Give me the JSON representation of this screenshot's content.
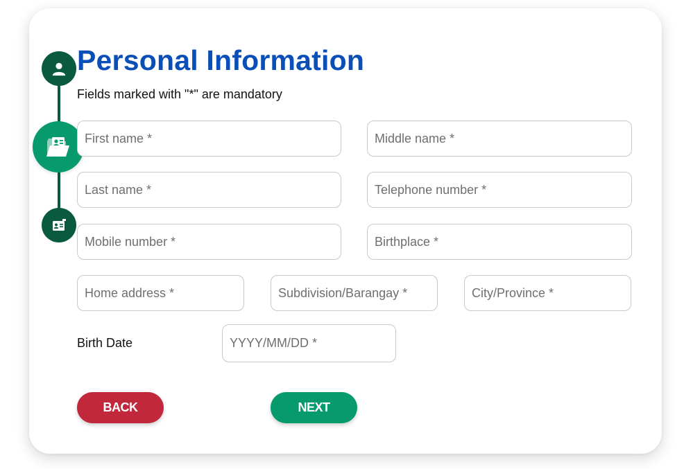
{
  "header": {
    "title": "Personal Information",
    "subtitle": "Fields marked with \"*\" are mandatory"
  },
  "stepper": {
    "steps": [
      {
        "icon": "user-icon",
        "state": "completed"
      },
      {
        "icon": "folder-id-icon",
        "state": "active"
      },
      {
        "icon": "id-card-icon",
        "state": "upcoming"
      }
    ],
    "colors": {
      "completed": "#0a5a3f",
      "active": "#079a6c",
      "upcoming": "#0a5a3f"
    }
  },
  "form": {
    "first_name": {
      "placeholder": "First name *",
      "value": ""
    },
    "middle_name": {
      "placeholder": "Middle name *",
      "value": ""
    },
    "last_name": {
      "placeholder": "Last name *",
      "value": ""
    },
    "telephone": {
      "placeholder": "Telephone number *",
      "value": ""
    },
    "mobile": {
      "placeholder": "Mobile number *",
      "value": ""
    },
    "birthplace": {
      "placeholder": "Birthplace *",
      "value": ""
    },
    "home_address": {
      "placeholder": "Home address *",
      "value": ""
    },
    "subdivision": {
      "placeholder": "Subdivision/Barangay *",
      "value": ""
    },
    "city_province": {
      "placeholder": "City/Province *",
      "value": ""
    },
    "birth_date": {
      "label": "Birth Date",
      "placeholder": "YYYY/MM/DD *",
      "value": ""
    }
  },
  "buttons": {
    "back_label": "BACK",
    "next_label": "NEXT"
  },
  "colors": {
    "title": "#0a4fb8",
    "back_button": "#c1283c",
    "next_button": "#079a6c"
  }
}
